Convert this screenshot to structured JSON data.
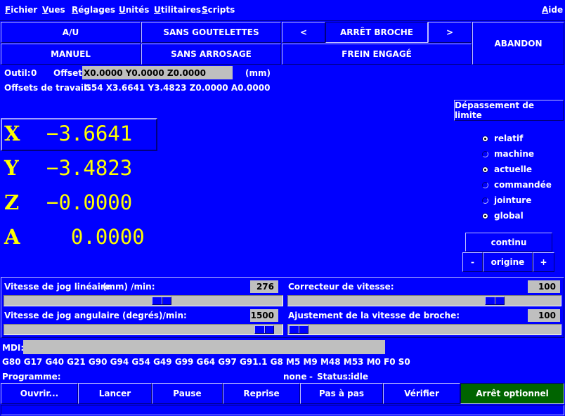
{
  "menubar": {
    "items": [
      {
        "label": "Fichier",
        "u": "F",
        "rest": "ichier"
      },
      {
        "label": "Vues",
        "u": "V",
        "rest": "ues"
      },
      {
        "label": "Réglages",
        "u": "R",
        "rest": "églages"
      },
      {
        "label": "Unités",
        "u": "U",
        "rest": "nités"
      },
      {
        "label": "Utilitaires",
        "u": "U",
        "rest": "tilitaires"
      },
      {
        "label": "Scripts",
        "u": "S",
        "rest": "cripts"
      }
    ],
    "help": {
      "label": "Aide",
      "u": "A",
      "rest": "ide"
    }
  },
  "toolbar": {
    "estop": "A/U",
    "mode": "MANUEL",
    "mist": "SANS GOUTELETTES",
    "flood": "SANS ARROSAGE",
    "spindle_dec": "<",
    "spindle_state": "ARRÊT BROCHE",
    "spindle_inc": ">",
    "brake": "FREIN ENGAGÉ",
    "abort": "ABANDON"
  },
  "tool_info": {
    "tool_label": "Outil:",
    "tool_value": "0",
    "offset_label": "Offset:",
    "offset_value": "X0.0000 Y0.0000 Z0.0000",
    "units": "(mm)",
    "work_offsets_label": "Offsets de travail:",
    "work_offsets_value": "G54 X3.6641 Y3.4823 Z0.0000 A0.0000"
  },
  "dro": {
    "axes": [
      {
        "axis": "X",
        "value": "−3.6641"
      },
      {
        "axis": "Y",
        "value": "−3.4823"
      },
      {
        "axis": "Z",
        "value": "−0.0000"
      },
      {
        "axis": "A",
        "value": "  0.0000"
      }
    ]
  },
  "right_panel": {
    "limit_override": "Dépassement de limite",
    "radios": [
      {
        "label": "relatif",
        "checked": true
      },
      {
        "label": "machine",
        "checked": false
      },
      {
        "label": "actuelle",
        "checked": true
      },
      {
        "label": "commandée",
        "checked": false
      },
      {
        "label": "jointure",
        "checked": false
      },
      {
        "label": "global",
        "checked": true
      }
    ],
    "jog_mode": "continu",
    "jog_minus": "-",
    "home": "origine",
    "jog_plus": "+"
  },
  "sliders": {
    "linear_jog": {
      "label": "Vitesse de jog linéaire",
      "unit": "(mm) /min:",
      "value": "276",
      "fraction": 0.57
    },
    "angular_jog": {
      "label": "Vitesse de jog angulaire (degrés)/min:",
      "value": "1500",
      "fraction": 0.97
    },
    "feed_override": {
      "label": "Correcteur de vitesse:",
      "value": "100",
      "fraction": 0.78
    },
    "spindle_override": {
      "label": "Ajustement de la vitesse de broche:",
      "value": "100",
      "fraction": 0.0
    }
  },
  "mdi": {
    "label": "MDI:",
    "value": "",
    "gcodes": "G80 G17 G40 G21 G90 G94 G54 G49 G99 G64 G97 G91.1 G8 M5 M9 M48 M53 M0 F0 S0"
  },
  "program": {
    "label": "Programme:",
    "file": "none",
    "dash": "-",
    "status_label": "Status:",
    "status": "idle"
  },
  "bottom_buttons": {
    "open": "Ouvrir...",
    "run": "Lancer",
    "pause": "Pause",
    "resume": "Reprise",
    "step": "Pas à pas",
    "verify": "Vérifier",
    "optional_stop": "Arrêt optionnel"
  },
  "colors": {
    "background": "#0000ff",
    "dro_text": "#ffff00",
    "optional_stop_active": "#006400",
    "field": "#bfbfbf"
  }
}
